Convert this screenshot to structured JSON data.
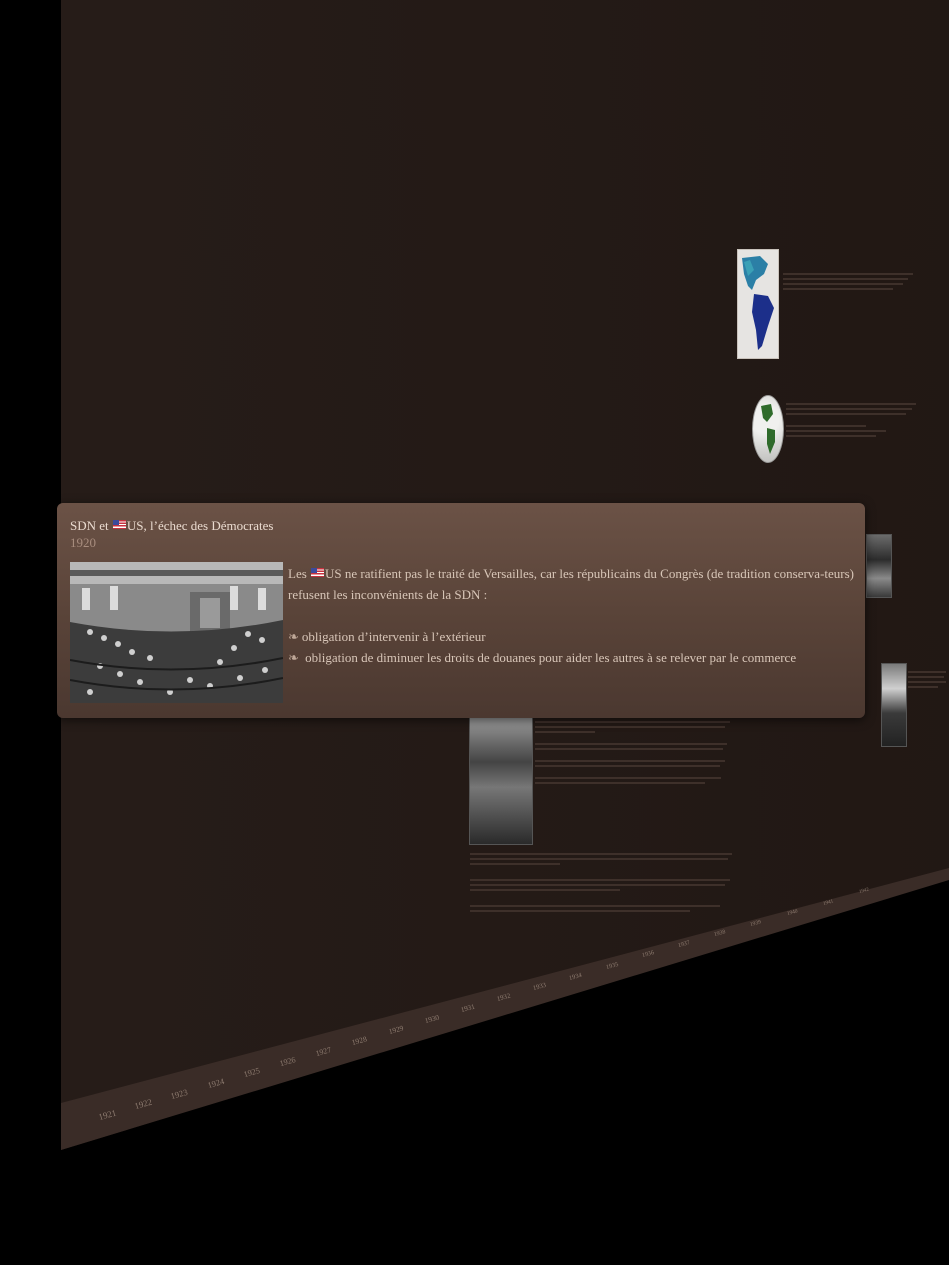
{
  "card": {
    "title_prefix": "SDN et",
    "title_flag": "us-flag-icon",
    "title_suffix": "US, l’échec des Démocrates",
    "date": "1920",
    "text_prefix": "Les",
    "text_flag": "us-flag-icon",
    "text_body": "US ne ratifient pas le traité de Versailles, car les républicains du Congrès (de tradition conserva-teurs) refusent les inconvénients de la SDN :",
    "bullets": [
      {
        "marker": "❧",
        "text": "obligation d’intervenir à l’extérieur"
      },
      {
        "marker": "❧",
        "text": "obligation de diminuer les droits de douanes pour aider les autres à   se relever par le commerce"
      }
    ]
  },
  "timeline": {
    "years": [
      "1921",
      "1922",
      "1923",
      "1924",
      "1925",
      "1926",
      "1927",
      "1928",
      "1929",
      "1930",
      "1931",
      "1932",
      "1933",
      "1934",
      "1935",
      "1936",
      "1937",
      "1938",
      "1939",
      "1940",
      "1941",
      "1942"
    ]
  },
  "colors": {
    "board": "#231915",
    "card_top": "#6b5246",
    "card_bottom": "#4b3830",
    "page_background": "#000000"
  }
}
